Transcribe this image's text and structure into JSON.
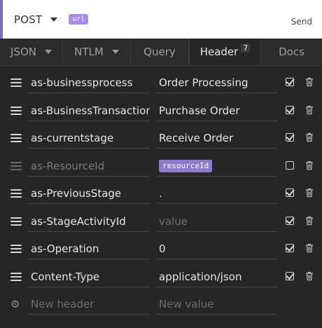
{
  "request": {
    "method": "POST",
    "url_tag": "url",
    "send_label": "Send"
  },
  "tabs": [
    {
      "label": "JSON",
      "has_caret": true
    },
    {
      "label": "NTLM",
      "has_caret": true
    },
    {
      "label": "Query"
    },
    {
      "label": "Header",
      "badge": "7",
      "active": true
    },
    {
      "label": "Docs"
    }
  ],
  "headers": [
    {
      "name": "as-businessprocess",
      "value": "Order Processing",
      "enabled": true
    },
    {
      "name": "as-BusinessTransaction",
      "value": "Purchase Order",
      "enabled": true
    },
    {
      "name": "as-currentstage",
      "value": "Receive Order",
      "enabled": true
    },
    {
      "name": "as-ResourceId",
      "value": "resourceId",
      "enabled": false,
      "value_is_tag": true
    },
    {
      "name": "as-PreviousStage",
      "value": ".",
      "enabled": true
    },
    {
      "name": "as-StageActivityId",
      "value": "",
      "placeholder": "value",
      "enabled": true
    },
    {
      "name": "as-Operation",
      "value": "0",
      "enabled": true
    },
    {
      "name": "Content-Type",
      "value": "application/json",
      "enabled": true
    }
  ],
  "new_header": {
    "name_placeholder": "New header",
    "value_placeholder": "New value"
  }
}
